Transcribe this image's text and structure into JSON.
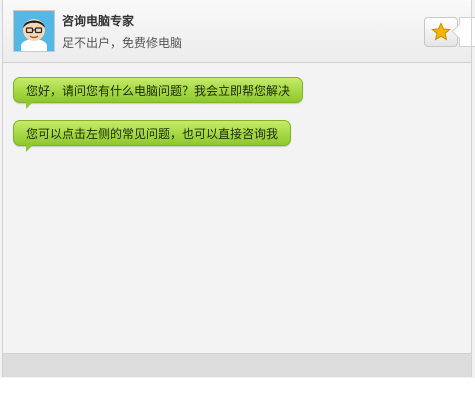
{
  "header": {
    "title": "咨询电脑专家",
    "subtitle": "足不出户，免费修电脑",
    "avatar_icon": "expert-avatar-icon",
    "favorite_icon": "star-icon"
  },
  "messages": [
    {
      "text": "您好，请问您有什么电脑问题？我会立即帮您解决"
    },
    {
      "text": "您可以点击左侧的常见问题，也可以直接咨询我"
    }
  ],
  "colors": {
    "bubble_top": "#c6eb6b",
    "bubble_mid": "#a5d843",
    "bubble_bottom": "#8fc72f",
    "bubble_border": "#7fb425",
    "star": "#f2b600"
  }
}
